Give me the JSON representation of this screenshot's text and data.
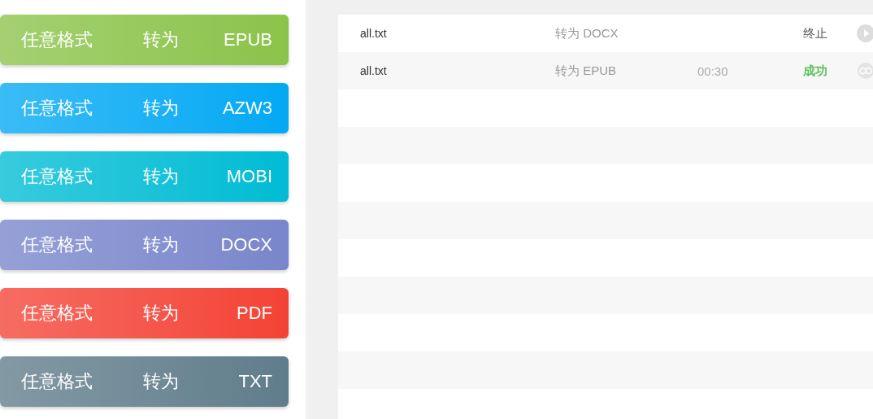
{
  "formats": [
    {
      "source": "任意格式",
      "verb": "转为",
      "target": "EPUB",
      "color": "#8bc34a"
    },
    {
      "source": "任意格式",
      "verb": "转为",
      "target": "AZW3",
      "color": "#03a9f4"
    },
    {
      "source": "任意格式",
      "verb": "转为",
      "target": "MOBI",
      "color": "#00bcd4"
    },
    {
      "source": "任意格式",
      "verb": "转为",
      "target": "DOCX",
      "color": "#7986cb"
    },
    {
      "source": "任意格式",
      "verb": "转为",
      "target": "PDF",
      "color": "#f44336"
    },
    {
      "source": "任意格式",
      "verb": "转为",
      "target": "TXT",
      "color": "#607d8b"
    }
  ],
  "tasks": [
    {
      "file": "all.txt",
      "action": "转为 DOCX",
      "status": "终止",
      "kind": "stopped"
    },
    {
      "file": "all.txt",
      "action": "转为 EPUB",
      "time": "00:30",
      "status": "成功",
      "kind": "success"
    }
  ]
}
